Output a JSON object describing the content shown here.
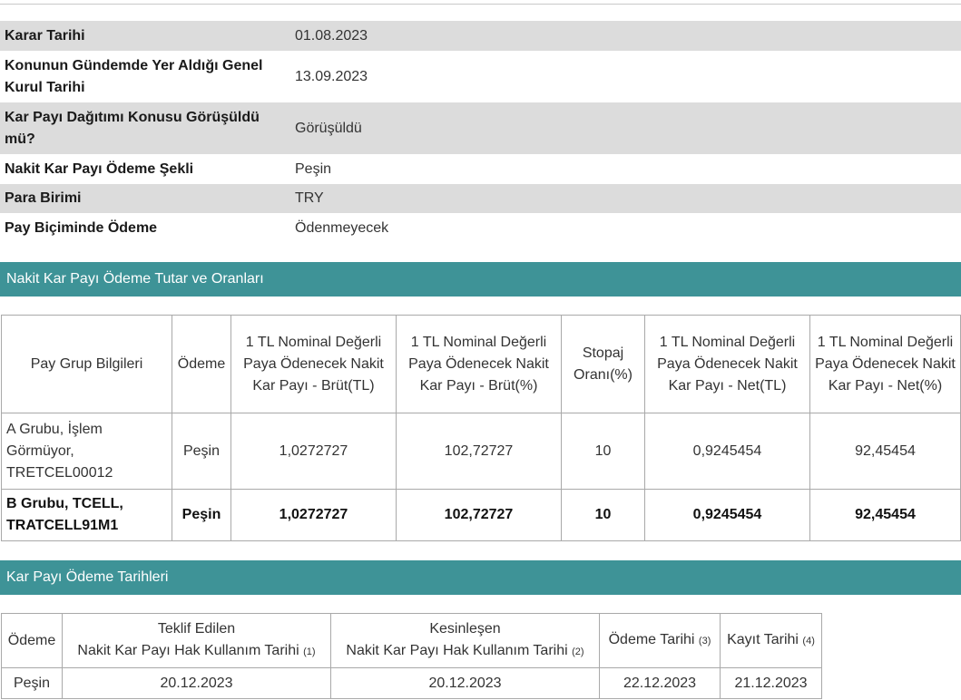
{
  "info": {
    "rows": [
      {
        "label": "Karar Tarihi",
        "value": "01.08.2023"
      },
      {
        "label": "Konunun Gündemde Yer Aldığı Genel Kurul Tarihi",
        "value": "13.09.2023"
      },
      {
        "label": "Kar Payı Dağıtımı Konusu Görüşüldü mü?",
        "value": "Görüşüldü"
      },
      {
        "label": "Nakit Kar Payı Ödeme Şekli",
        "value": "Peşin"
      },
      {
        "label": "Para Birimi",
        "value": "TRY"
      },
      {
        "label": "Pay Biçiminde Ödeme",
        "value": "Ödenmeyecek"
      }
    ]
  },
  "section1": {
    "title": "Nakit Kar Payı Ödeme Tutar ve Oranları",
    "headers": [
      "Pay Grup Bilgileri",
      "Ödeme",
      "1 TL Nominal Değerli Paya Ödenecek Nakit Kar Payı - Brüt(TL)",
      "1 TL Nominal Değerli Paya Ödenecek Nakit Kar Payı - Brüt(%)",
      "Stopaj Oranı(%)",
      "1 TL Nominal Değerli Paya Ödenecek Nakit Kar Payı - Net(TL)",
      "1 TL Nominal Değerli Paya Ödenecek Nakit Kar Payı - Net(%)"
    ],
    "rows": [
      {
        "group": "A Grubu, İşlem Görmüyor, TRETCEL00012",
        "payment": "Peşin",
        "gross_tl": "1,0272727",
        "gross_pct": "102,72727",
        "withholding": "10",
        "net_tl": "0,9245454",
        "net_pct": "92,45454"
      },
      {
        "group": "B Grubu, TCELL, TRATCELL91M1",
        "payment": "Peşin",
        "gross_tl": "1,0272727",
        "gross_pct": "102,72727",
        "withholding": "10",
        "net_tl": "0,9245454",
        "net_pct": "92,45454"
      }
    ]
  },
  "section2": {
    "title": "Kar Payı Ödeme Tarihleri",
    "headers": {
      "payment": "Ödeme",
      "proposed_line1": "Teklif Edilen",
      "proposed_line2": "Nakit Kar Payı Hak Kullanım Tarihi",
      "proposed_note": "(1)",
      "final_line1": "Kesinleşen",
      "final_line2": "Nakit Kar Payı Hak Kullanım Tarihi",
      "final_note": "(2)",
      "pay_date": "Ödeme Tarihi",
      "pay_date_note": "(3)",
      "record_date": "Kayıt Tarihi",
      "record_date_note": "(4)"
    },
    "row": {
      "payment": "Peşin",
      "proposed": "20.12.2023",
      "final": "20.12.2023",
      "pay_date": "22.12.2023",
      "record_date": "21.12.2023"
    }
  }
}
